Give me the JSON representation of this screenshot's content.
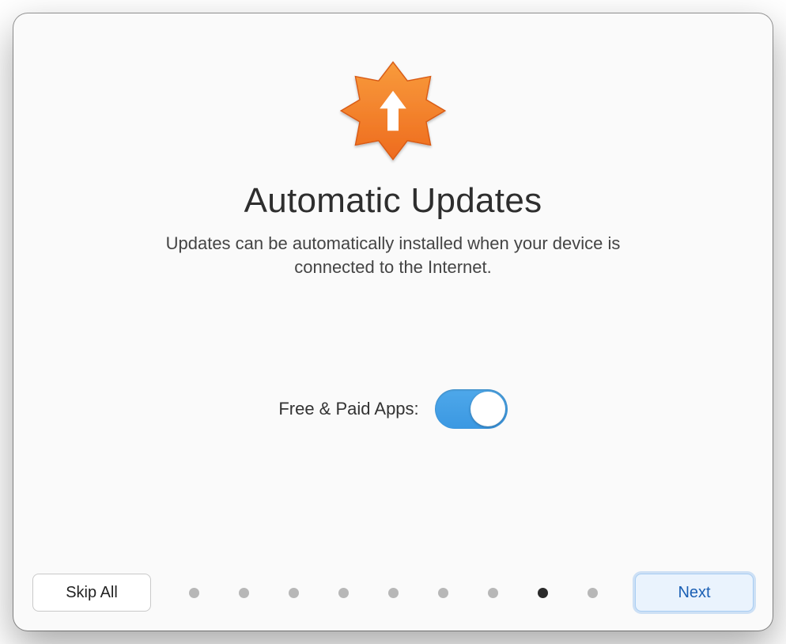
{
  "header": {
    "title": "Automatic Updates",
    "subtitle": "Updates can be automatically installed when your device is connected to the Internet."
  },
  "toggle": {
    "label": "Free & Paid Apps:",
    "state": "on"
  },
  "pager": {
    "total": 9,
    "active_index": 7
  },
  "footer": {
    "skip_label": "Skip All",
    "next_label": "Next"
  }
}
